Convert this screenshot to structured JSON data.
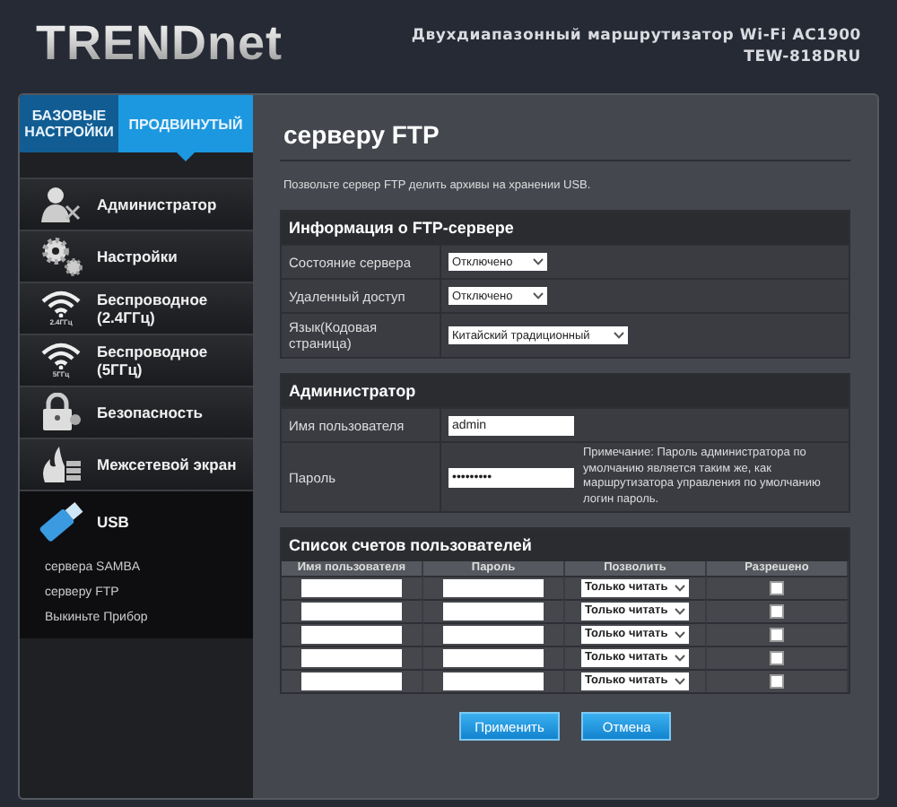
{
  "header": {
    "logo": "TRENDnet",
    "product": "Двухдиапазонный маршрутизатор Wi-Fi AC1900",
    "model": "TEW-818DRU"
  },
  "mode_tabs": [
    {
      "label": "БАЗОВЫЕ НАСТРОЙКИ",
      "selected": false
    },
    {
      "label": "ПРОДВИНУТЫЙ",
      "selected": true
    }
  ],
  "sidebar": {
    "items": [
      {
        "label": "Администратор",
        "kind": "admin",
        "selected": false
      },
      {
        "label": "Настройки",
        "kind": "gear",
        "selected": false
      },
      {
        "label": "Беспроводное (2.4ГГц)",
        "kind": "wifi",
        "icon_caption": "2.4ГГц",
        "selected": false
      },
      {
        "label": "Беспроводное (5ГГц)",
        "kind": "wifi",
        "icon_caption": "5ГГц",
        "selected": false
      },
      {
        "label": "Безопасность",
        "kind": "lock",
        "selected": false
      },
      {
        "label": "Межсетевой экран",
        "kind": "fire",
        "selected": false
      },
      {
        "label": "USB",
        "kind": "usb",
        "selected": true,
        "children": [
          {
            "label": "сервера SAMBA"
          },
          {
            "label": "серверу FTP"
          },
          {
            "label": "Выкиньте Прибор"
          }
        ]
      }
    ]
  },
  "content": {
    "title": "серверу FTP",
    "description": "Позвольте сервер FTP делить архивы на хранении USB.",
    "sections": [
      {
        "kind": "form",
        "title": "Информация о FTP-сервере",
        "rows": [
          {
            "label": "Состояние сервера",
            "kind": "select",
            "value": "Отключено"
          },
          {
            "label": "Удаленный доступ",
            "kind": "select",
            "value": "Отключено"
          },
          {
            "label": "Язык(Кодовая страница)",
            "kind": "select",
            "value": "Китайский традиционный"
          }
        ]
      },
      {
        "kind": "form",
        "title": "Администратор",
        "rows": [
          {
            "label": "Имя пользователя",
            "kind": "text",
            "value": "admin"
          },
          {
            "label": "Пароль",
            "kind": "password",
            "value": "•••••••••",
            "note": "Примечание: Пароль администратора по умолчанию является таким же, как маршрутизатора управления по умолчанию логин пароль."
          }
        ]
      },
      {
        "kind": "table",
        "title": "Список счетов пользователей",
        "columns": [
          "Имя пользователя",
          "Пароль",
          "Позволить",
          "Разрешено"
        ],
        "rows": [
          {
            "permission": "Только читать",
            "allowed": false
          },
          {
            "permission": "Только читать",
            "allowed": false
          },
          {
            "permission": "Только читать",
            "allowed": false
          },
          {
            "permission": "Только читать",
            "allowed": false
          },
          {
            "permission": "Только читать",
            "allowed": false
          }
        ]
      }
    ],
    "buttons": [
      "Применить",
      "Отмена"
    ]
  }
}
